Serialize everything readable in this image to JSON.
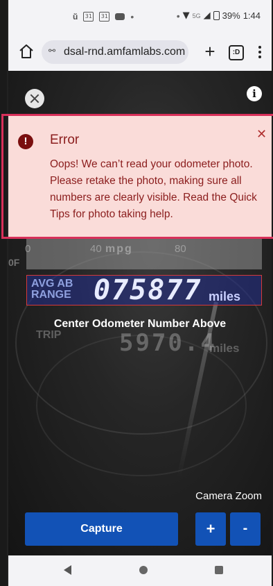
{
  "status_bar": {
    "time": "1:44",
    "battery": "39%",
    "network": "5G",
    "calendar_day_1": "31",
    "calendar_day_2": "31"
  },
  "browser": {
    "url": "dsal-rnd.amfamlabs.com",
    "tabs_count": ":D",
    "url_icon": "⚯"
  },
  "error": {
    "title": "Error",
    "message": "Oops! We can’t read your odometer photo. Please retake the photo, making sure all numbers are clearly visible. Read the Quick Tips for photo taking help.",
    "icon_glyph": "!",
    "close_glyph": "✕",
    "color_bg": "#fadcd9",
    "color_text": "#8b1d1d"
  },
  "camera": {
    "gauge_units": "mpg",
    "gauge_left_num": "40",
    "gauge_right_num": "80",
    "gauge_far_left": "0",
    "odometer_digits": "075877",
    "odometer_units": "miles",
    "odometer_side_label_1": "AVG AB",
    "odometer_side_label_2": "RANGE",
    "trip_label": "TRIP",
    "trip_digits": "5970.4",
    "trip_units": "miles",
    "left_edge_text": "0F"
  },
  "instructions": {
    "center_label": "Center Odometer Number Above"
  },
  "controls": {
    "zoom_label": "Camera Zoom",
    "capture_label": "Capture",
    "zoom_in_label": "+",
    "zoom_out_label": "-",
    "accent_color": "#1252b6"
  }
}
